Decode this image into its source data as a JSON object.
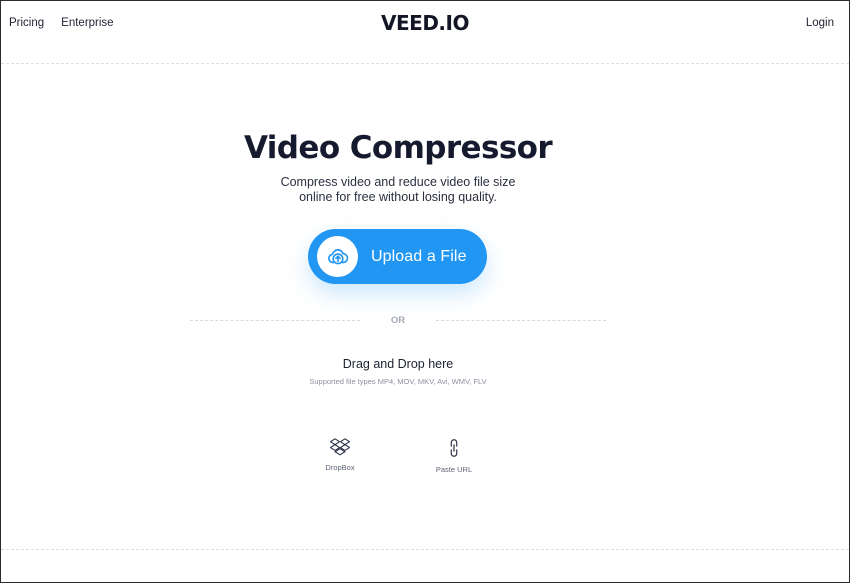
{
  "header": {
    "nav": [
      {
        "label": "Pricing"
      },
      {
        "label": "Enterprise"
      }
    ],
    "logo": "VEED.IO",
    "login_label": "Login"
  },
  "hero": {
    "title": "Video Compressor",
    "subtitle_line1": "Compress video and reduce video file size",
    "subtitle_line2": "online for free without losing quality.",
    "upload_label": "Upload a File",
    "upload_icon": "cloud-upload-icon",
    "accent_color": "#2196f3"
  },
  "divider": {
    "or_text": "OR"
  },
  "dropzone": {
    "title": "Drag and Drop here",
    "supported": "Supported file types MP4, MOV, MKV, Avi, WMV, FLV"
  },
  "sources": [
    {
      "label": "DropBox",
      "icon": "dropbox-icon"
    },
    {
      "label": "Paste URL",
      "icon": "link-icon"
    }
  ]
}
